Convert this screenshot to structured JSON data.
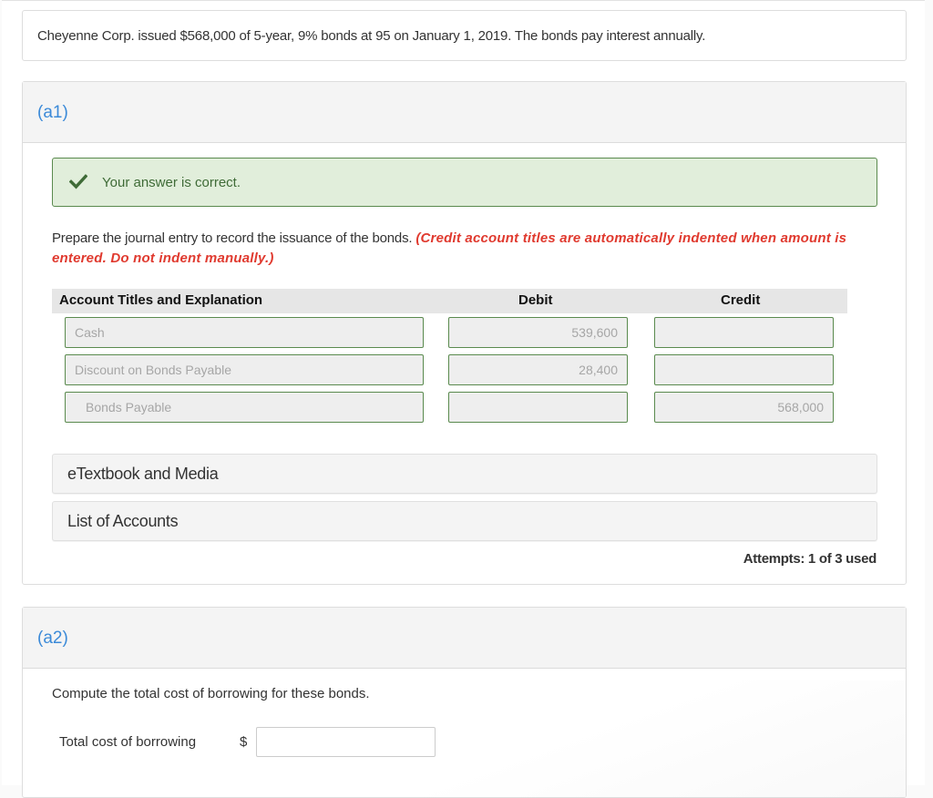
{
  "problem": {
    "text": "Cheyenne Corp. issued $568,000 of 5-year, 9% bonds at 95 on January 1, 2019. The bonds pay interest annually."
  },
  "part_a1": {
    "label": "(a1)",
    "feedback": {
      "icon": "check-icon",
      "text": "Your answer is correct.",
      "color": "#3f6b37"
    },
    "instructions": "Prepare the journal entry to record the issuance of the bonds.",
    "note": "(Credit account titles are automatically indented when amount is entered. Do not indent manually.)",
    "table": {
      "headers": {
        "account": "Account Titles and Explanation",
        "debit": "Debit",
        "credit": "Credit"
      },
      "rows": [
        {
          "account": "Cash",
          "debit": "539,600",
          "credit": ""
        },
        {
          "account": "Discount on Bonds Payable",
          "debit": "28,400",
          "credit": ""
        },
        {
          "account": "Bonds Payable",
          "debit": "",
          "credit": "568,000"
        }
      ]
    },
    "links": {
      "etextbook": "eTextbook and Media",
      "list_of_accounts": "List of Accounts"
    },
    "attempts": "Attempts: 1 of 3 used"
  },
  "part_a2": {
    "label": "(a2)",
    "question": "Compute the total cost of borrowing for these bonds.",
    "field_label": "Total cost of borrowing",
    "currency": "$",
    "value": ""
  },
  "colors": {
    "accent_label": "#3b8ad8",
    "correct_bg": "#e1eedb",
    "correct_border": "#5a8a4e",
    "note_red": "#e03a2f"
  }
}
